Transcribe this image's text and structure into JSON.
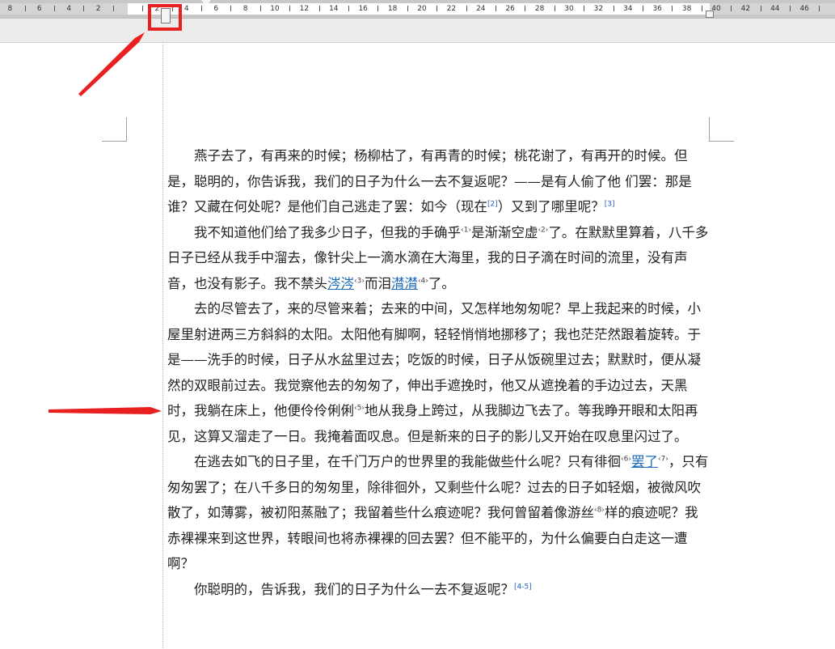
{
  "ruler": {
    "numbers_left": [
      "8",
      "6",
      "4",
      "2"
    ],
    "numbers_right": [
      "4",
      "6",
      "8",
      "10",
      "12",
      "14",
      "16",
      "18",
      "20",
      "22",
      "24",
      "26",
      "28",
      "30",
      "32",
      "34",
      "36",
      "38",
      "40",
      "42",
      "44",
      "46"
    ],
    "first_number": "2"
  },
  "colors": {
    "highlight": "#e8201f",
    "link": "#1e6bb8",
    "text": "#222222"
  },
  "paragraphs": [
    {
      "runs": [
        {
          "t": "燕子去了，有再来的时候；杨柳枯了，有再青的时候；桃花谢了，有再开的时候。但是，聪明的，你告诉我，我们的日子为什么一去不复返呢？——是有人偷了他 们罢：那是谁？又藏在何处呢？是他们自己逃走了罢：如今（现在"
        },
        {
          "t": "[2]",
          "sup": true,
          "link": true
        },
        {
          "t": "）又到了哪里呢？"
        },
        {
          "t": "[3]",
          "sup": true,
          "link": true
        }
      ]
    },
    {
      "runs": [
        {
          "t": "我不知道他们给了我多少日子，但我的手确乎"
        },
        {
          "t": "‹1›",
          "sup": true
        },
        {
          "t": "是渐渐空虚"
        },
        {
          "t": "‹2›",
          "sup": true
        },
        {
          "t": "了。在默默里算着，八千多日子已经从我手中溜去，像针尖上一滴水滴在大海里，我的日子滴在时间的流里，没有声音，也没有影子。我不禁头"
        },
        {
          "t": "涔涔",
          "u": true
        },
        {
          "t": "‹3›",
          "sup": true
        },
        {
          "t": "而泪"
        },
        {
          "t": "潸潸",
          "u": true
        },
        {
          "t": "‹4›",
          "sup": true
        },
        {
          "t": "了。"
        }
      ]
    },
    {
      "runs": [
        {
          "t": "去的尽管去了，来的尽管来着；去来的中间，又怎样地匆匆呢？早上我起来的时候，小屋里射进两三方斜斜的太阳。太阳他有脚啊，轻轻悄悄地挪移了；我也茫茫然跟着旋转。于是——洗手的时候，日子从水盆里过去；吃饭的时候，日子从饭碗里过去；默默时，便从凝然的双眼前过去。我觉察他去的匆匆了，伸出手遮挽时，他又从遮挽着的手边过去，天黑时，我躺在床上，他便伶伶俐俐"
        },
        {
          "t": "‹5›",
          "sup": true
        },
        {
          "t": "地从我身上跨过，从我脚边飞去了。等我睁开眼和太阳再见，这算又溜走了一日。我掩着面叹息。但是新来的日子的影儿又开始在叹息里闪过了。"
        }
      ]
    },
    {
      "runs": [
        {
          "t": "在逃去如飞的日子里，在千门万户的世界里的我能做些什么呢？只有徘徊"
        },
        {
          "t": "‹6›",
          "sup": true
        },
        {
          "t": "罢了",
          "u": true
        },
        {
          "t": "‹7›",
          "sup": true
        },
        {
          "t": "，只有匆匆罢了；在八千多日的匆匆里，除徘徊外，又剩些什么呢？过去的日子如轻烟，被微风吹散了，如薄雾，被初阳蒸融了；我留着些什么痕迹呢？我何曾留着像游丝"
        },
        {
          "t": "‹8›",
          "sup": true
        },
        {
          "t": "样的痕迹呢？我赤裸裸来到这世界，转眼间也将赤裸裸的回去罢？但不能平的，为什么偏要白白走这一遭啊？"
        }
      ]
    },
    {
      "runs": [
        {
          "t": "你聪明的，告诉我，我们的日子为什么一去不复返呢？"
        },
        {
          "t": "[4-5]",
          "sup": true,
          "link": true
        }
      ]
    }
  ]
}
